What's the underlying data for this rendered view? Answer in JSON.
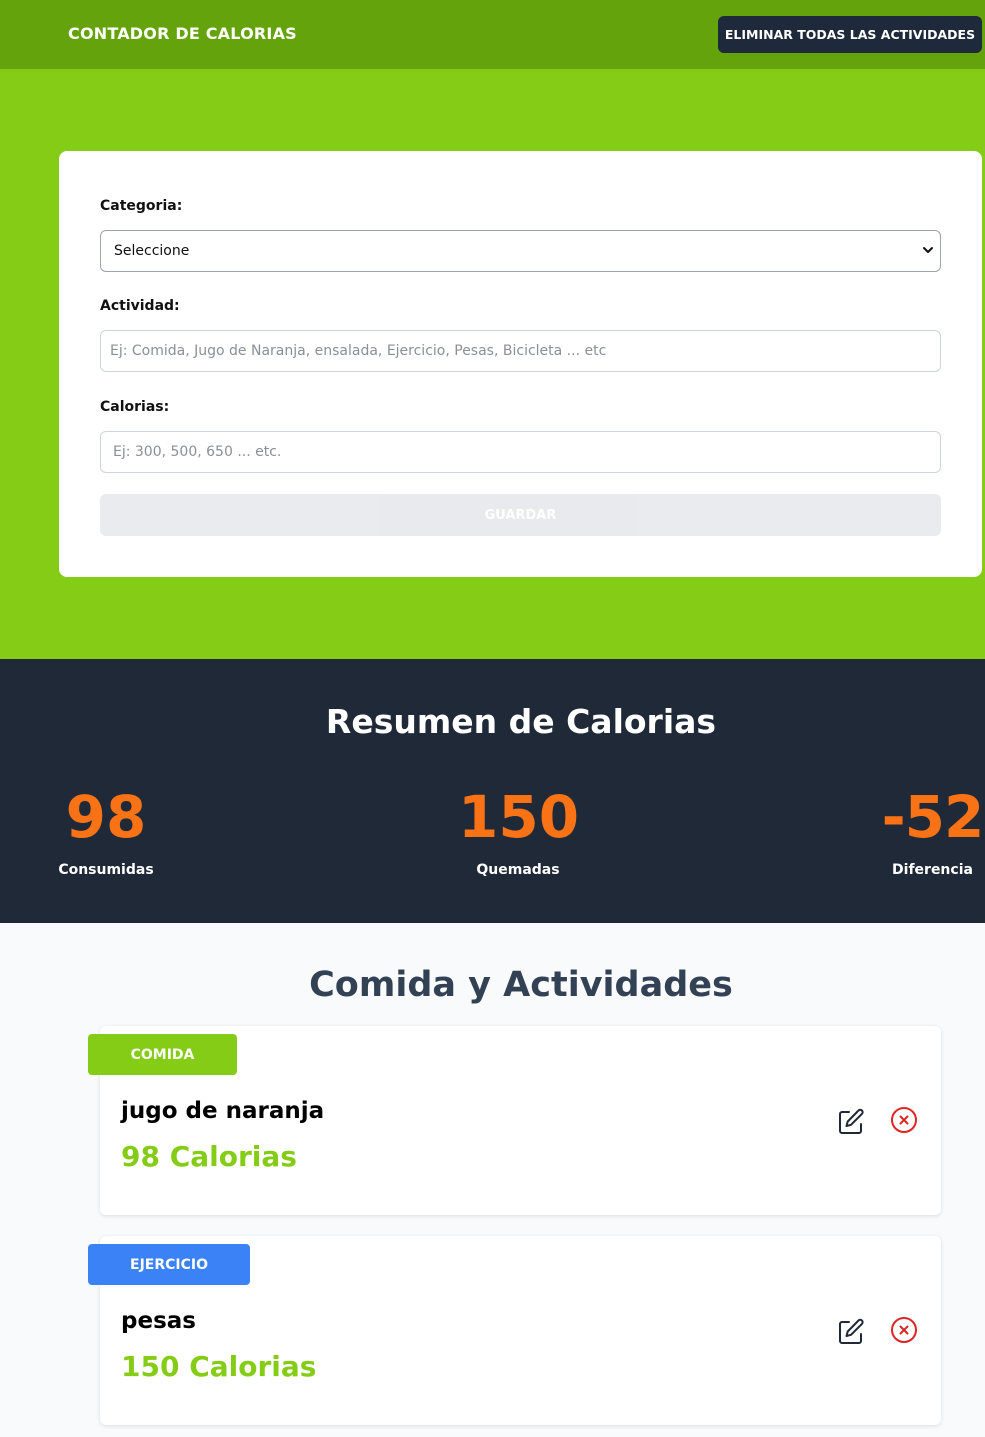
{
  "header": {
    "title": "CONTADOR DE CALORIAS",
    "clear_button": "ELIMINAR TODAS LAS ACTIVIDADES"
  },
  "form": {
    "category_label": "Categoria:",
    "category_value": "Seleccione",
    "activity_label": "Actividad:",
    "activity_placeholder": "Ej: Comida, Jugo de Naranja, ensalada, Ejercicio, Pesas, Bicicleta ... etc",
    "calories_label": "Calorias:",
    "calories_placeholder": "Ej: 300, 500, 650 ... etc.",
    "save_button": "GUARDAR"
  },
  "summary": {
    "title": "Resumen de Calorias",
    "consumed_value": "98",
    "consumed_label": "Consumidas",
    "burned_value": "150",
    "burned_label": "Quemadas",
    "difference_value": "-52",
    "difference_label": "Diferencia"
  },
  "activities": {
    "title": "Comida y Actividades",
    "items": [
      {
        "category": "COMIDA",
        "name": "jugo de naranja",
        "calories": "98 Calorias",
        "badge_color": "#84cc16"
      },
      {
        "category": "EJERCICIO",
        "name": "pesas",
        "calories": "150 Calorias",
        "badge_color": "#3b82f6"
      }
    ]
  },
  "colors": {
    "header_bg": "#65a30d",
    "hero_bg": "#84cc16",
    "summary_bg": "#1f2937",
    "accent_orange": "#f97316",
    "delete_red": "#dc2626"
  },
  "icons": [
    "chevron-down-icon",
    "edit-icon",
    "delete-icon"
  ]
}
